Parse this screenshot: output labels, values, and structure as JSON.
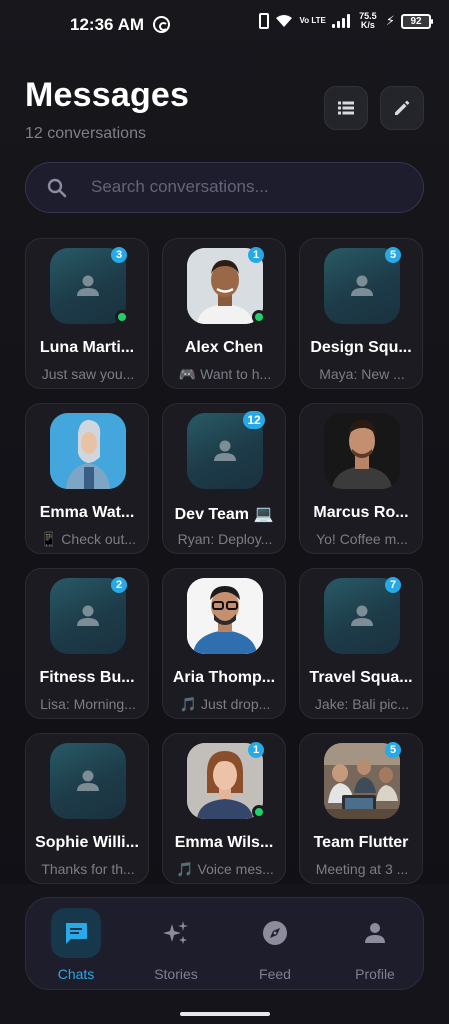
{
  "status_bar": {
    "time": "12:36 AM",
    "network": "Vo LTE",
    "speed": "75.5 K/s",
    "battery": "92"
  },
  "header": {
    "title": "Messages",
    "subtitle": "12 conversations",
    "list_icon": "list-icon",
    "edit_icon": "edit-pencil-icon"
  },
  "search": {
    "placeholder": "Search conversations...",
    "value": ""
  },
  "colors": {
    "accent": "#27a9e8",
    "online": "#1fd16a",
    "card_bg": "#1b1b21"
  },
  "conversations": [
    {
      "name": "Luna Marti...",
      "preview": "Just saw you...",
      "badge": "3",
      "online": true,
      "avatar": "placeholder"
    },
    {
      "name": "Alex Chen",
      "preview": "🎮 Want to h...",
      "badge": "1",
      "online": true,
      "avatar": "photo"
    },
    {
      "name": "Design Squ...",
      "preview": "Maya: New ...",
      "badge": "5",
      "online": false,
      "avatar": "placeholder"
    },
    {
      "name": "Emma Wat...",
      "preview": "📱 Check out...",
      "badge": "",
      "online": false,
      "avatar": "photo"
    },
    {
      "name": "Dev Team 💻",
      "preview": "Ryan: Deploy...",
      "badge": "12",
      "online": false,
      "avatar": "placeholder"
    },
    {
      "name": "Marcus Ro...",
      "preview": "Yo! Coffee m...",
      "badge": "",
      "online": false,
      "avatar": "photo"
    },
    {
      "name": "Fitness Bu...",
      "preview": "Lisa: Morning...",
      "badge": "2",
      "online": false,
      "avatar": "placeholder"
    },
    {
      "name": "Aria Thomp...",
      "preview": "🎵 Just drop...",
      "badge": "",
      "online": false,
      "avatar": "photo"
    },
    {
      "name": "Travel Squa...",
      "preview": "Jake: Bali pic...",
      "badge": "7",
      "online": false,
      "avatar": "placeholder"
    },
    {
      "name": "Sophie Willi...",
      "preview": "Thanks for th...",
      "badge": "",
      "online": false,
      "avatar": "placeholder"
    },
    {
      "name": "Emma Wils...",
      "preview": "🎵 Voice mes...",
      "badge": "1",
      "online": true,
      "avatar": "photo"
    },
    {
      "name": "Team Flutter",
      "preview": "Meeting at 3 ...",
      "badge": "5",
      "online": false,
      "avatar": "photo"
    }
  ],
  "nav": {
    "items": [
      {
        "label": "Chats",
        "icon": "chat-bubble-icon",
        "active": true
      },
      {
        "label": "Stories",
        "icon": "sparkles-icon",
        "active": false
      },
      {
        "label": "Feed",
        "icon": "compass-icon",
        "active": false
      },
      {
        "label": "Profile",
        "icon": "person-icon",
        "active": false
      }
    ]
  }
}
